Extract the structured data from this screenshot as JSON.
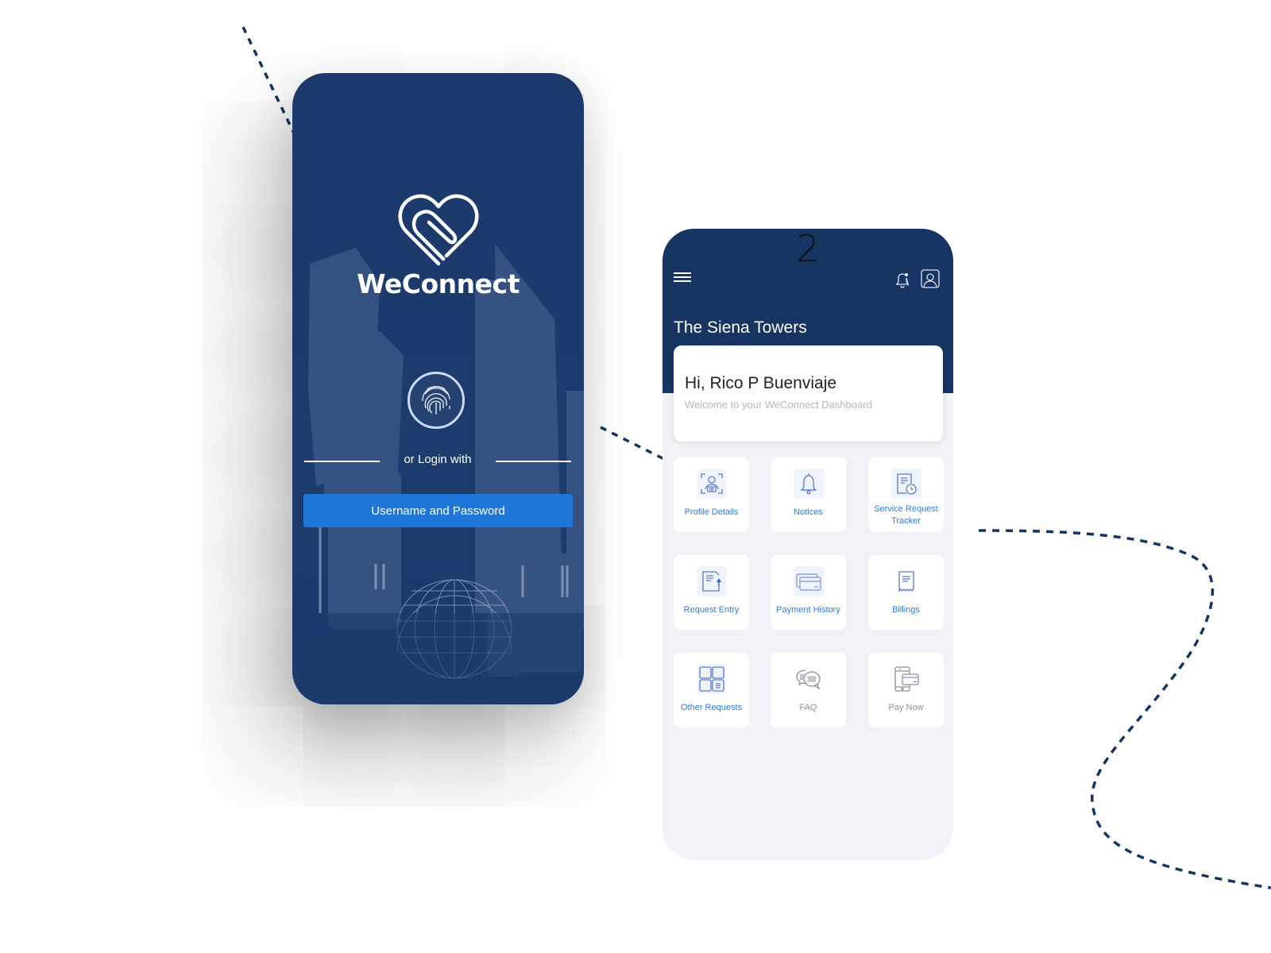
{
  "login_screen": {
    "brand_name": "WeConnect",
    "fingerprint_icon": "fingerprint-icon",
    "or_login_with": "or Login with",
    "username_password_button": "Username and Password",
    "colors": {
      "background": "#1b3a6b",
      "button": "#1e76d8"
    }
  },
  "dashboard_screen": {
    "page_number": "2",
    "header": {
      "menu_icon": "hamburger-menu-icon",
      "notification_icon": "bell-icon",
      "profile_icon": "profile-icon",
      "building_name": "The Siena Towers"
    },
    "welcome": {
      "greeting": "Hi, Rico P Buenviaje",
      "subtitle": "Welcome to your WeConnect Dashboard"
    },
    "tiles": [
      {
        "label": "Profile Details",
        "icon": "profile-details-icon"
      },
      {
        "label": "Notices",
        "icon": "bell-icon"
      },
      {
        "label": "Service Request Tracker",
        "icon": "service-tracker-icon"
      },
      {
        "label": "Request Entry",
        "icon": "request-entry-icon"
      },
      {
        "label": "Payment History",
        "icon": "cards-icon"
      },
      {
        "label": "Billings",
        "icon": "receipt-icon"
      },
      {
        "label": "Other Requests",
        "icon": "grid-icon"
      },
      {
        "label": "FAQ",
        "icon": "chat-bubbles-icon"
      },
      {
        "label": "Pay Now",
        "icon": "mobile-payment-icon"
      }
    ],
    "colors": {
      "header": "#163563",
      "tile_label": "#2d7be0",
      "tile_label_muted": "#8d9096",
      "background": "#eff3f8"
    }
  }
}
